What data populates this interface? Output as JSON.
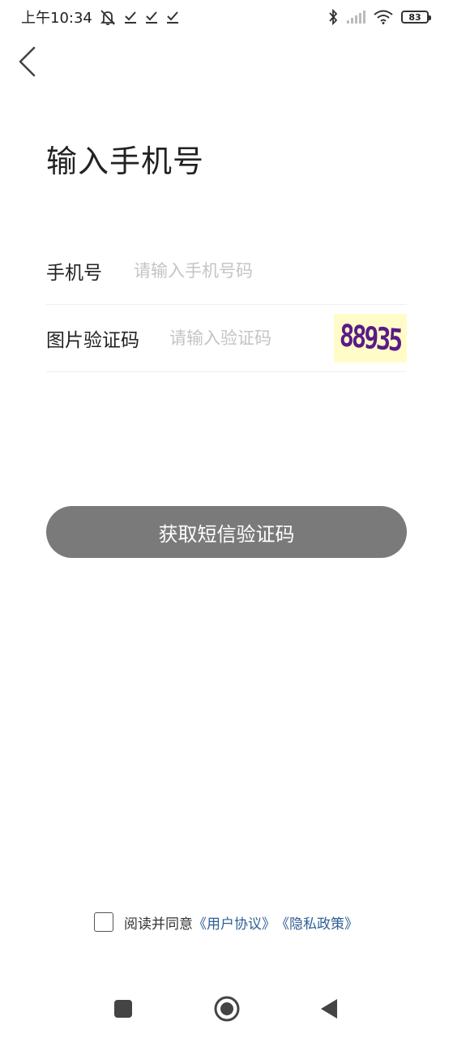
{
  "status_bar": {
    "time": "上午10:34",
    "battery_level": "83",
    "icons": [
      "mute-icon",
      "check-icon",
      "check-icon",
      "check-icon",
      "bluetooth-icon",
      "signal-icon",
      "wifi-icon",
      "battery-icon"
    ]
  },
  "header": {
    "back_icon": "chevron-left-icon",
    "title": "输入手机号"
  },
  "form": {
    "phone": {
      "label": "手机号",
      "placeholder": "请输入手机号码",
      "value": ""
    },
    "captcha": {
      "label": "图片验证码",
      "placeholder": "请输入验证码",
      "value": "",
      "image_text": "88935"
    }
  },
  "submit": {
    "label": "获取短信验证码",
    "color": "#7a7a7a"
  },
  "agreement": {
    "checked": false,
    "prefix": "阅读并同意",
    "user_agreement": "《用户协议》",
    "privacy_policy": "《隐私政策》",
    "link_color": "#2f5f95"
  },
  "nav_bar": {
    "icons": [
      "square-icon",
      "circle-icon",
      "triangle-back-icon"
    ]
  }
}
